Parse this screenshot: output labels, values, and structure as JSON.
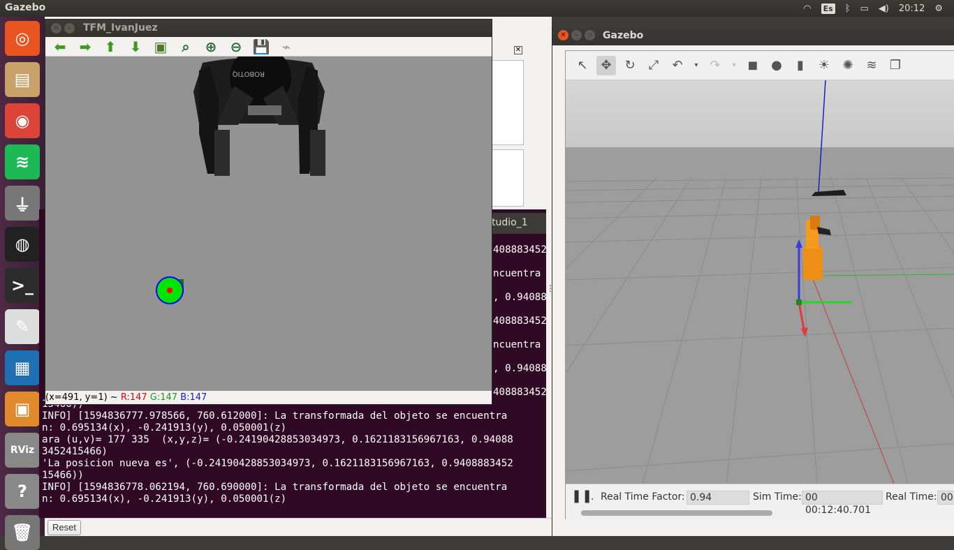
{
  "topbar": {
    "app_name": "Gazebo",
    "keyboard": "Es",
    "clock": "20:12"
  },
  "launcher": [
    {
      "name": "ubuntu-dash-icon",
      "glyph": "◎",
      "color": "#e95420"
    },
    {
      "name": "files-icon",
      "glyph": "▤",
      "color": "#c9a26a"
    },
    {
      "name": "chrome-icon",
      "glyph": "◉",
      "color": "#db4437"
    },
    {
      "name": "spotify-icon",
      "glyph": "≋",
      "color": "#1db954"
    },
    {
      "name": "usb-drive-icon",
      "glyph": "⏚",
      "color": "#777"
    },
    {
      "name": "camera-icon",
      "glyph": "◍",
      "color": "#222"
    },
    {
      "name": "terminal-icon",
      "glyph": ">_",
      "color": "#2c2c2c"
    },
    {
      "name": "text-editor-icon",
      "glyph": "✎",
      "color": "#ddd"
    },
    {
      "name": "writer-icon",
      "glyph": "▦",
      "color": "#1e6fb3"
    },
    {
      "name": "virtualbox-icon",
      "glyph": "▣",
      "color": "#e28a2b"
    },
    {
      "name": "rviz-icon",
      "glyph": "RViz",
      "color": "#888"
    },
    {
      "name": "help-icon",
      "glyph": "?",
      "color": "#888"
    },
    {
      "name": "trash-icon",
      "glyph": "🗑",
      "color": "#777"
    }
  ],
  "tfm": {
    "title": "TFM_IvanJuez",
    "status": {
      "coords": "(x=491, y=1) ~ ",
      "r": "R:147",
      "g": "G:147",
      "b": "B:147"
    },
    "robot_label": "ROBOTIQ"
  },
  "terminal": {
    "tab_label": "tudio_1",
    "right_lines": [
      "408883452",
      "ncuentra",
      ", 0.94088",
      "408883452",
      "ncuentra",
      ", 0.94088",
      "408883452"
    ],
    "lines": [
      "15466))",
      "INFO] [1594836777.978566, 760.612000]: La transformada del objeto se encuentra",
      "n: 0.695134(x), -0.241913(y), 0.050001(z)",
      "ara (u,v)= 177 335  (x,y,z)= (-0.24190428853034973, 0.1621183156967163, 0.94088",
      "3452415466)",
      "'La posicion nueva es', (-0.24190428853034973, 0.1621183156967163, 0.9408883452",
      "15466))",
      "INFO] [1594836778.062194, 760.690000]: La transformada del objeto se encuentra",
      "n: 0.695134(x), -0.241913(y), 0.050001(z)"
    ],
    "reset_label": "Reset"
  },
  "gazebo": {
    "title": "Gazebo",
    "real_time_factor_label": "Real Time Factor:",
    "real_time_factor": "0.94",
    "sim_time_label": "Sim Time:",
    "sim_time": "00 00:12:40.701",
    "real_time_label": "Real Time:",
    "real_time": "00 0"
  }
}
